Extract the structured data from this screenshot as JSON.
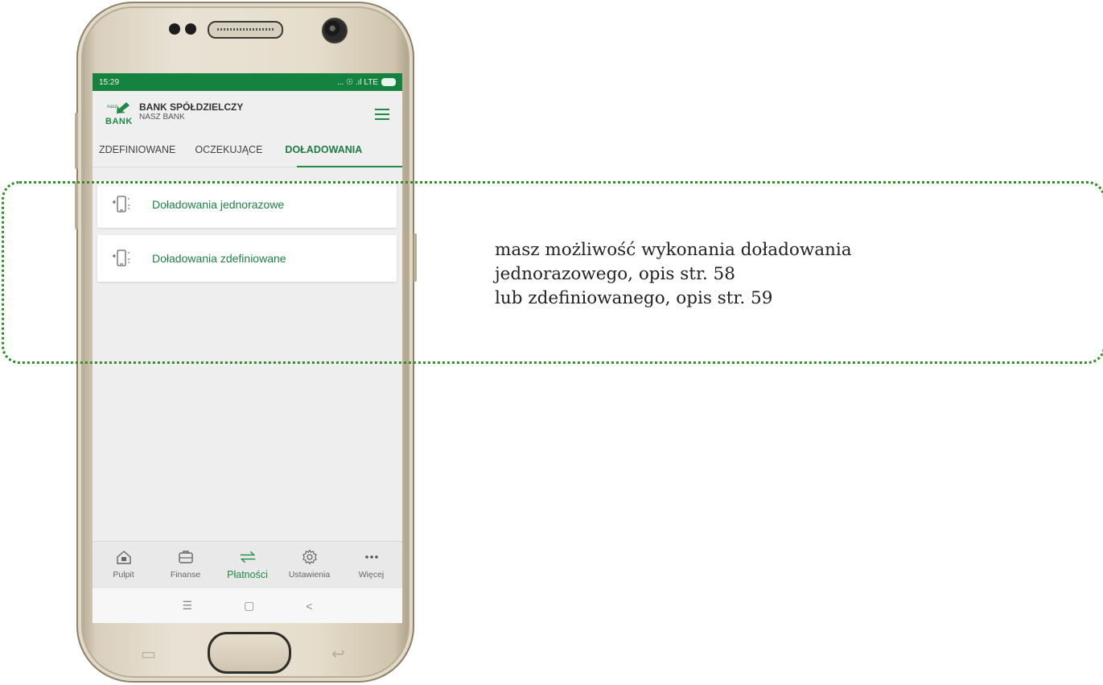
{
  "status_bar": {
    "time": "15:29",
    "indicators": "... ☉ .ıl LTE"
  },
  "app": {
    "logo_small": "nasz",
    "logo_word": "BANK",
    "bank_title": "BANK SPÓŁDZIELCZY",
    "bank_subtitle": "NASZ BANK"
  },
  "tabs": [
    {
      "label": "ZDEFINIOWANE",
      "active": false
    },
    {
      "label": "OCZEKUJĄCE",
      "active": false
    },
    {
      "label": "DOŁADOWANIA",
      "active": true
    }
  ],
  "topup_options": [
    {
      "label": "Doładowania jednorazowe",
      "icon": "mobile-topup-icon"
    },
    {
      "label": "Doładowania zdefiniowane",
      "icon": "mobile-topup-icon"
    }
  ],
  "bottom_nav": [
    {
      "label": "Pulpit",
      "icon": "home-icon",
      "active": false
    },
    {
      "label": "Finanse",
      "icon": "wallet-icon",
      "active": false
    },
    {
      "label": "Płatności",
      "icon": "transfer-arrows-icon",
      "active": true
    },
    {
      "label": "Ustawienia",
      "icon": "gear-icon",
      "active": false
    },
    {
      "label": "Więcej",
      "icon": "more-icon",
      "active": false
    }
  ],
  "caption": {
    "line1": "masz możliwość wykonania doładowania",
    "line2": "jednorazowego, opis str. 58",
    "line3": "lub zdefiniowanego, opis str. 59"
  },
  "colors": {
    "brand_green": "#1f8a45",
    "status_bar": "#168240",
    "callout_border": "#2f8f26"
  }
}
